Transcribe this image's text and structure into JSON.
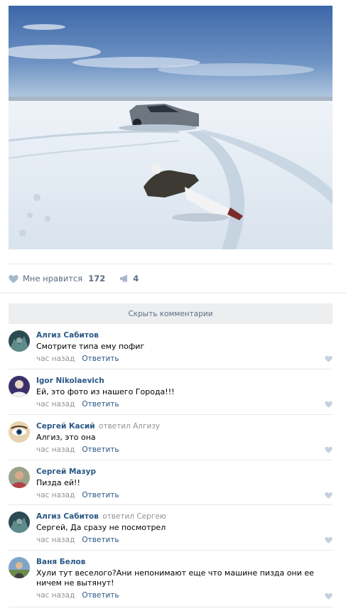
{
  "post": {
    "photo_icon": "snow-lake-car-photo",
    "likes_label": "Мне нравится",
    "likes_count": "172",
    "shares_count": "4"
  },
  "comments_toggle": "Скрыть комментарии",
  "comments": [
    {
      "author": "Алгиз Сабитов",
      "reply_to": "",
      "text": "Смотрите типа ему пофиг",
      "time": "час назад",
      "reply": "Ответить"
    },
    {
      "author": "Igor Nikolaevich",
      "reply_to": "",
      "text": "Ей, это фото из нашего Города!!!",
      "time": "час назад",
      "reply": "Ответить"
    },
    {
      "author": "Сергей Касий",
      "reply_to": "ответил Алгизу",
      "text": "Алгиз, это она",
      "time": "час назад",
      "reply": "Ответить"
    },
    {
      "author": "Сергей Мазур",
      "reply_to": "",
      "text": "Пизда ей!!",
      "time": "час назад",
      "reply": "Ответить"
    },
    {
      "author": "Алгиз Сабитов",
      "reply_to": "ответил Сергею",
      "text": "Сергей, Да сразу не посмотрел",
      "time": "час назад",
      "reply": "Ответить"
    },
    {
      "author": "Ваня Белов",
      "reply_to": "",
      "text": "Хули тут веселого?Ани непонимают еще что машине пизда они ее ничем не вытянут!",
      "time": "час назад",
      "reply": "Ответить"
    }
  ],
  "colors": {
    "link": "#2a5885",
    "muted": "#939393",
    "action": "#5b6c83",
    "toggle_bg": "#edeef0"
  }
}
